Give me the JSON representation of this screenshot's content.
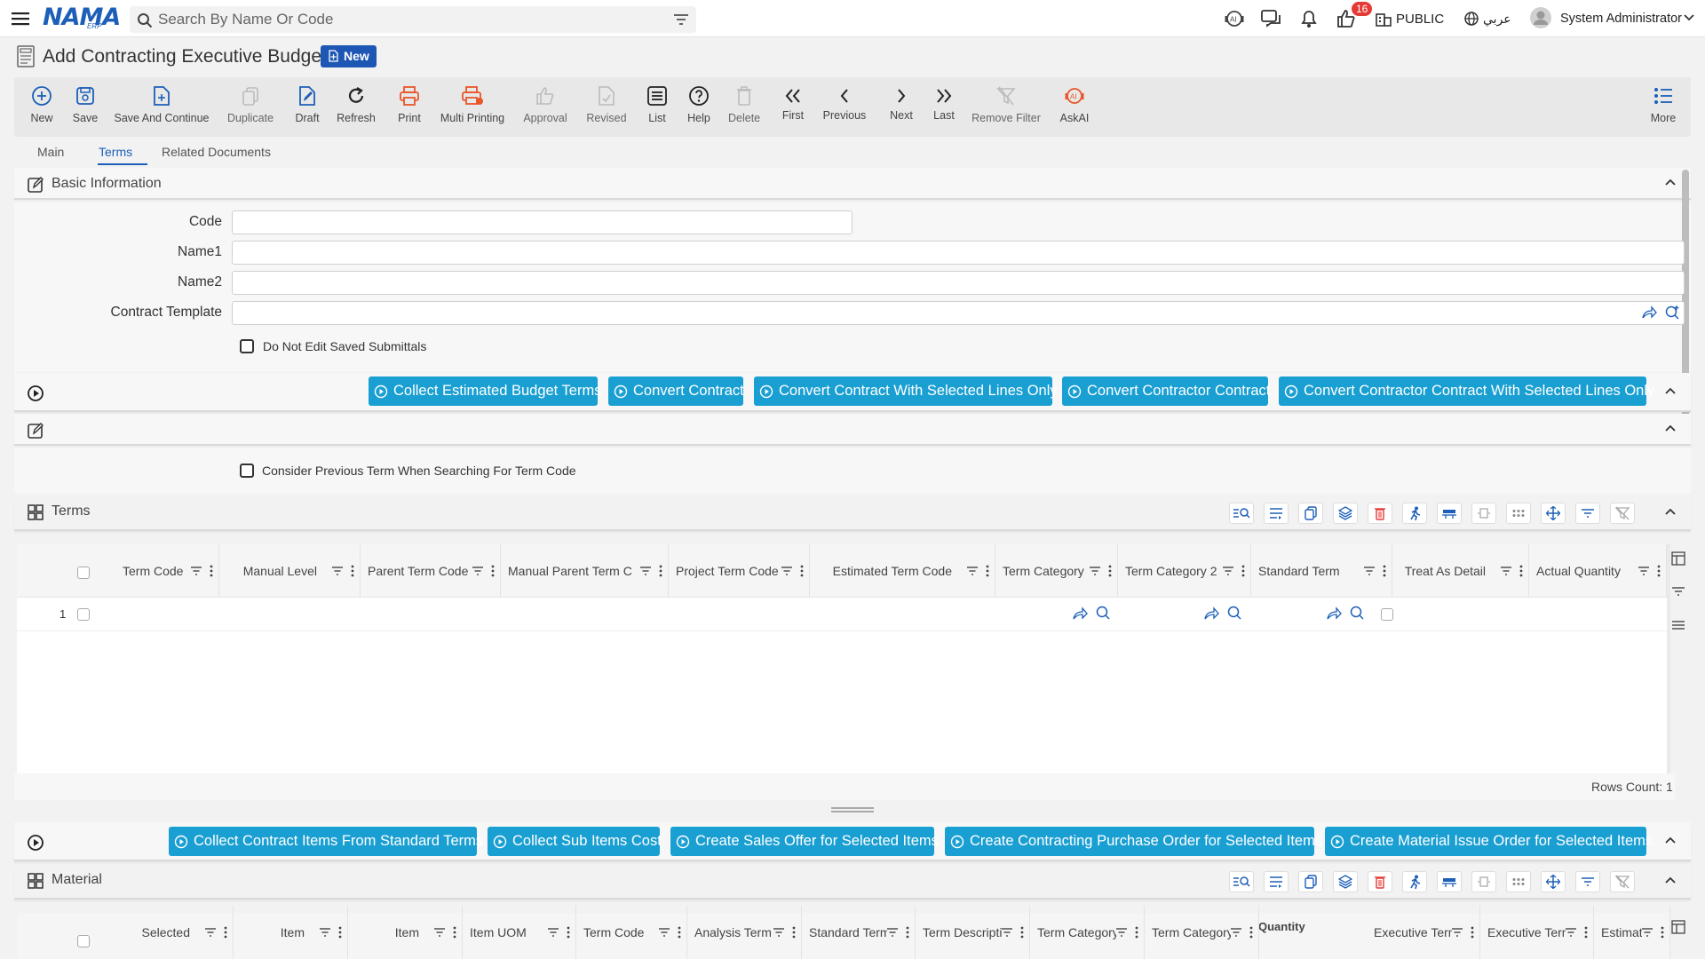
{
  "app": {
    "logo": "NAMA",
    "logo_sub": "ERP",
    "search_placeholder": "Search By Name Or Code",
    "notif_count": "16",
    "branch": "PUBLIC",
    "language": "عربي",
    "user": "System Administrator"
  },
  "page": {
    "title": "Add Contracting Executive Budget",
    "status": "New"
  },
  "toolbar": {
    "new": "New",
    "save": "Save",
    "save_continue": "Save And Continue",
    "duplicate": "Duplicate",
    "draft": "Draft",
    "refresh": "Refresh",
    "print": "Print",
    "multi_printing": "Multi Printing",
    "approval": "Approval",
    "revised": "Revised",
    "list": "List",
    "help": "Help",
    "delete": "Delete",
    "first": "First",
    "previous": "Previous",
    "next": "Next",
    "last": "Last",
    "remove_filter": "Remove Filter",
    "askai": "AskAI",
    "more": "More"
  },
  "tabs": [
    "Main",
    "Terms",
    "Related Documents"
  ],
  "basic_info": {
    "title": "Basic Information",
    "code_label": "Code",
    "name1_label": "Name1",
    "name2_label": "Name2",
    "template_label": "Contract Template",
    "do_not_edit": "Do Not Edit Saved Submittals"
  },
  "actions1": [
    "Collect Estimated Budget Terms",
    "Convert Contract",
    "Convert Contract With Selected Lines Only",
    "Convert Contractor Contract",
    "Convert Contractor Contract With Selected Lines Only"
  ],
  "consider_prev": "Consider Previous Term When Searching For Term Code",
  "terms": {
    "title": "Terms",
    "columns": [
      "Term Code",
      "Manual Level",
      "Parent Term Code",
      "Manual Parent Term C",
      "Project Term Code",
      "Estimated Term Code",
      "Term Category",
      "Term Category 2",
      "Standard Term",
      "Treat As Detail",
      "Actual Quantity"
    ],
    "row_number": "1",
    "rows_count": "Rows Count: 1"
  },
  "actions2": [
    "Collect Contract Items From Standard Terms",
    "Collect Sub Items Cost",
    "Create Sales Offer for Selected Items",
    "Create Contracting Purchase Order for Selected Items",
    "Create Material Issue Order for Selected Items"
  ],
  "material": {
    "title": "Material",
    "group_label": "Quantity",
    "columns": [
      "Selected",
      "Item",
      "Item",
      "Item UOM",
      "Term Code",
      "Analysis Term",
      "Standard Term",
      "Term Description",
      "Term Category",
      "Term Category",
      "Executive Term",
      "Executive Term",
      "Estimated Ti"
    ]
  },
  "colors": {
    "accent": "#1d5fb8",
    "action": "#1a9fd2",
    "print": "#e8562a"
  }
}
